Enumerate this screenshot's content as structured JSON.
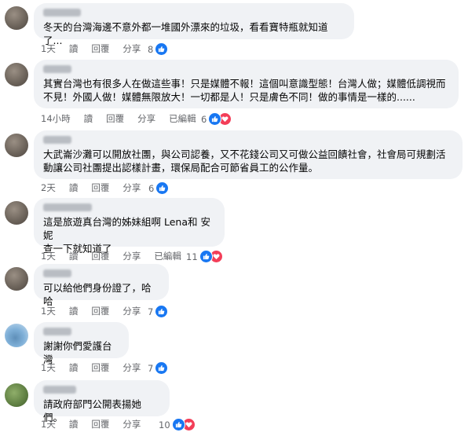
{
  "comments": [
    {
      "text": "冬天的台灣海邊不意外都一堆國外漂來的垃圾，看看寶特瓶就知道了...",
      "time": "1天",
      "read": "讀",
      "reply": "回覆",
      "share": "分享",
      "edited": "",
      "count": "8",
      "love": false,
      "avatar": "default"
    },
    {
      "text": "其實台灣也有很多人在做這些事！只是媒體不報！這個叫意識型態！台灣人做；媒體低調視而\n不見！外國人做！媒體無限放大！一切都是人！只是膚色不同！做的事情是一樣的......",
      "time": "14小時",
      "read": "讀",
      "reply": "回覆",
      "share": "分享",
      "edited": "已編輯",
      "count": "6",
      "love": true,
      "avatar": "default"
    },
    {
      "text": "大武崙沙灘可以開放社團，與公司認養，又不花錢公司又可做公益回饋社會，社會局可規劃活\n動讓公司社團提出認樣計畫，環保局配合可節省員工的公作量。",
      "time": "2天",
      "read": "讀",
      "reply": "回覆",
      "share": "分享",
      "edited": "",
      "count": "6",
      "love": false,
      "avatar": "default"
    },
    {
      "text": "這是旅遊真台灣的姊妹組啊 Lena和 安妮\n查一下就知道了",
      "time": "1天",
      "read": "讀",
      "reply": "回覆",
      "share": "分享",
      "edited": "已編輯",
      "count": "11",
      "love": true,
      "avatar": "default"
    },
    {
      "text": "可以給他們身份證了，哈哈",
      "time": "1天",
      "read": "讀",
      "reply": "回覆",
      "share": "分享",
      "edited": "",
      "count": "7",
      "love": false,
      "avatar": "default"
    },
    {
      "text": "謝謝你們愛護台灣",
      "time": "1天",
      "read": "讀",
      "reply": "回覆",
      "share": "分享",
      "edited": "",
      "count": "7",
      "love": false,
      "avatar": "sky"
    },
    {
      "text": "請政府部門公開表揚她們。",
      "time": "1天",
      "read": "讀",
      "reply": "回覆",
      "share": "分享",
      "edited": "",
      "count": "10",
      "love": true,
      "avatar": "green"
    }
  ],
  "icons": {
    "like": "like-icon",
    "love": "love-icon"
  },
  "colors": {
    "like": "#1877f2",
    "love": "#f33e58",
    "bubble": "#f0f2f5",
    "meta": "#65676b"
  }
}
